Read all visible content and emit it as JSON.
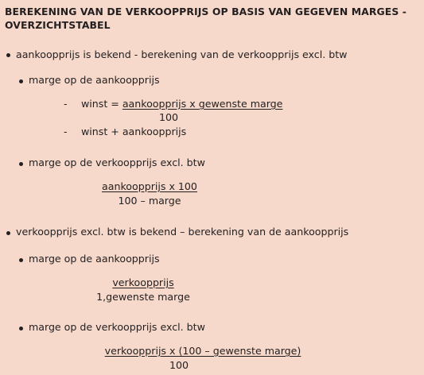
{
  "title": "BEREKENING VAN DE VERKOOPPRIJS OP BASIS VAN GEGEVEN MARGES - OVERZICHTSTABEL",
  "section1": {
    "heading": "aankoopprijs is bekend - berekening van de verkoopprijs excl. btw",
    "sub1": {
      "label": "marge op de aankoopprijs",
      "line1_prefix": "winst = ",
      "line1_numerator": "aankoopprijs x gewenste marge",
      "line1_denominator": "100",
      "line2": "winst + aankoopprijs"
    },
    "sub2": {
      "label": "marge op de verkoopprijs excl. btw",
      "numerator": "aankoopprijs x 100",
      "denominator": "100 – marge"
    }
  },
  "section2": {
    "heading": "verkoopprijs excl. btw is bekend – berekening van de aankoopprijs",
    "sub1": {
      "label": "marge op de aankoopprijs",
      "numerator": "verkoopprijs",
      "denominator": "1,gewenste marge"
    },
    "sub2": {
      "label": "marge op de verkoopprijs excl. btw",
      "numerator": "verkoopprijs x (100 – gewenste marge)",
      "denominator": "100"
    }
  }
}
